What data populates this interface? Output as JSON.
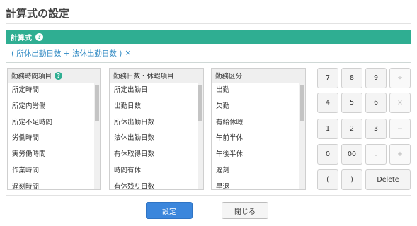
{
  "page": {
    "title": "計算式の設定"
  },
  "formula": {
    "header": "計算式",
    "help_icon": "?",
    "expression": "( 所休出勤日数 + 法休出勤日数 )",
    "clear": "×"
  },
  "lists": [
    {
      "header": "勤務時間項目",
      "has_help": true,
      "items": [
        "所定時間",
        "所定内労働",
        "所定不足時間",
        "労働時間",
        "実労働時間",
        "作業時間",
        "遅刻時間"
      ]
    },
    {
      "header": "勤務日数・休暇項目",
      "has_help": false,
      "items": [
        "所定出勤日",
        "出勤日数",
        "所休出勤日数",
        "法休出勤日数",
        "有休取得日数",
        "時間有休",
        "有休残り日数"
      ]
    },
    {
      "header": "勤務区分",
      "has_help": false,
      "items": [
        "出勤",
        "欠勤",
        "有給休暇",
        "午前半休",
        "午後半休",
        "遅刻",
        "早退"
      ]
    }
  ],
  "keypad": {
    "k7": "7",
    "k8": "8",
    "k9": "9",
    "div": "÷",
    "k4": "4",
    "k5": "5",
    "k6": "6",
    "mul": "×",
    "k1": "1",
    "k2": "2",
    "k3": "3",
    "minus": "−",
    "k0": "0",
    "k00": "00",
    "dot": ".",
    "plus": "+",
    "lparen": "(",
    "rparen": ")",
    "delete": "Delete"
  },
  "buttons": {
    "set": "設定",
    "close": "閉じる"
  },
  "colors": {
    "accent": "#2fae92",
    "primary": "#3b86dc",
    "link": "#2f89c3"
  },
  "icons": {
    "help": "question-circle-icon",
    "clear": "close-icon"
  }
}
